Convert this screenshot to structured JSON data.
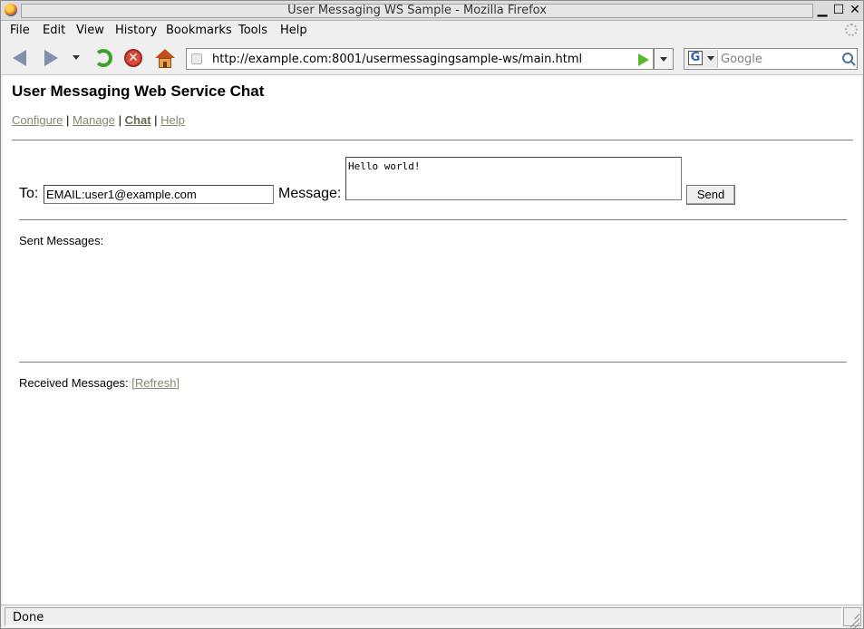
{
  "window": {
    "title": "User Messaging WS Sample - Mozilla Firefox",
    "minimize_glyph": "▁",
    "maximize_glyph": "☐",
    "close_glyph": "✕"
  },
  "menubar": {
    "items": [
      {
        "label": "File"
      },
      {
        "label": "Edit"
      },
      {
        "label": "View"
      },
      {
        "label": "History"
      },
      {
        "label": "Bookmarks"
      },
      {
        "label": "Tools"
      },
      {
        "label": "Help"
      }
    ]
  },
  "navbar": {
    "url": "http://example.com:8001/usermessagingsample-ws/main.html",
    "search_placeholder": "Google",
    "search_engine_letter": "G",
    "stop_glyph": "✕"
  },
  "page": {
    "title": "User Messaging Web Service Chat",
    "nav_links": [
      {
        "label": "Configure"
      },
      {
        "label": "Manage"
      },
      {
        "label": "Chat"
      },
      {
        "label": "Help"
      }
    ],
    "nav_separator": "|",
    "to_label": "To:",
    "to_value": "EMAIL:user1@example.com",
    "message_label": "Message:",
    "message_value": "Hello world!",
    "send_label": "Send",
    "sent_label": "Sent Messages:",
    "received_label": "Received Messages:",
    "refresh_label": "[Refresh]"
  },
  "statusbar": {
    "text": "Done"
  },
  "colors": {
    "link": "#8a8570",
    "active_link": "#6d6850",
    "chrome_bg": "#efefef"
  }
}
